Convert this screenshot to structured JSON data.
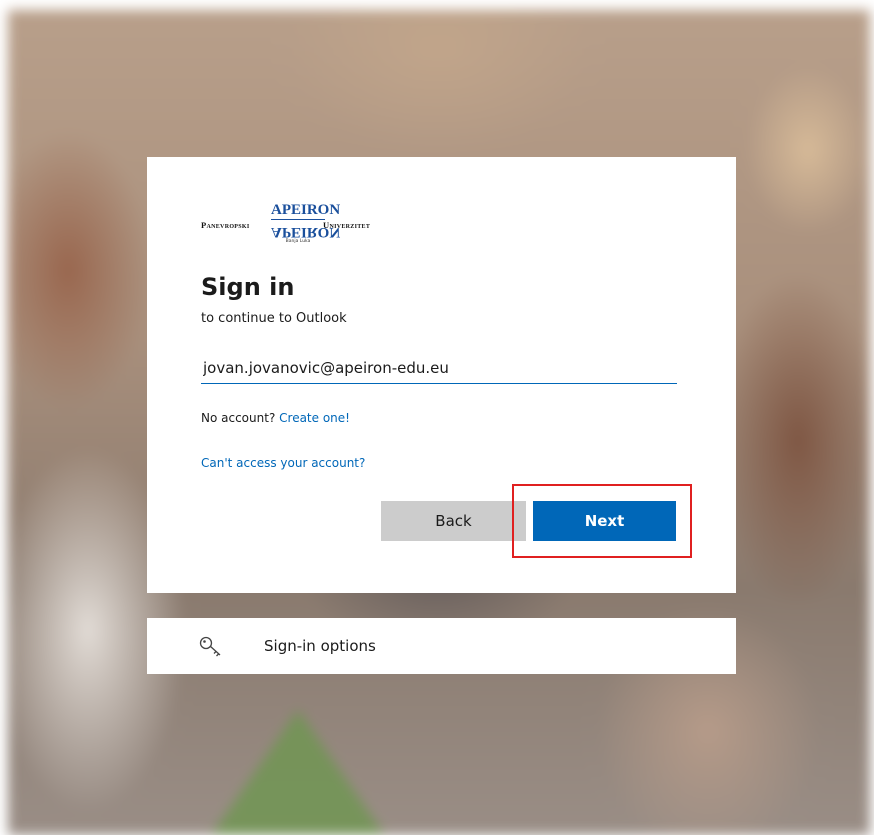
{
  "brand": {
    "left_text": "Panevropski",
    "logo_top": "APEIRON",
    "logo_bottom": "APEIRON",
    "logo_sub": "Banja Luka",
    "right_text": "Univerzitet"
  },
  "signin": {
    "title": "Sign in",
    "subtitle": "to continue to Outlook",
    "email_value": "jovan.jovanovic@apeiron-edu.eu",
    "no_account_prefix": "No account?",
    "create_link": "Create one!",
    "cant_access_link": "Can't access your account?",
    "back_label": "Back",
    "next_label": "Next"
  },
  "options": {
    "label": "Sign-in options",
    "icon": "key-icon"
  },
  "colors": {
    "accent": "#0067b8",
    "highlight": "#e02020",
    "back_button": "#cccccc"
  }
}
